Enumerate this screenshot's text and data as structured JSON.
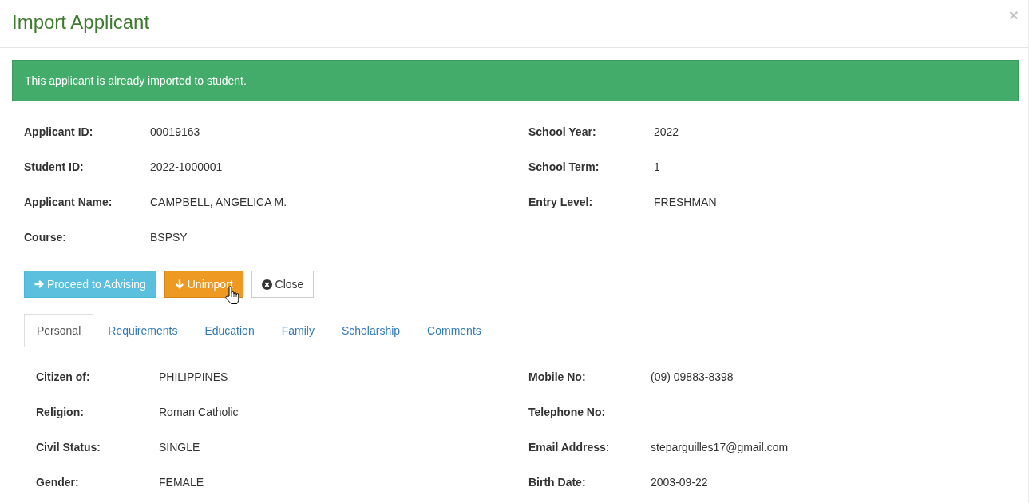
{
  "window": {
    "title": "Import Applicant",
    "close": "×"
  },
  "alert": {
    "message": "This applicant is already imported to student."
  },
  "summary": {
    "left": [
      {
        "label": "Applicant ID:",
        "value": "00019163"
      },
      {
        "label": "Student ID:",
        "value": "2022-1000001"
      },
      {
        "label": "Applicant Name:",
        "value": "CAMPBELL, ANGELICA M."
      },
      {
        "label": "Course:",
        "value": "BSPSY"
      }
    ],
    "right": [
      {
        "label": "School Year:",
        "value": "2022"
      },
      {
        "label": "School Term:",
        "value": "1"
      },
      {
        "label": "Entry Level:",
        "value": "FRESHMAN"
      }
    ]
  },
  "actions": [
    {
      "label": "Proceed to Advising",
      "kind": "proceed",
      "hovered": false
    },
    {
      "label": "Unimport",
      "kind": "unimport",
      "hovered": true
    },
    {
      "label": "Close",
      "kind": "close",
      "hovered": false
    }
  ],
  "tabs": [
    {
      "label": "Personal",
      "selected": true
    },
    {
      "label": "Requirements",
      "selected": false
    },
    {
      "label": "Education",
      "selected": false
    },
    {
      "label": "Family",
      "selected": false
    },
    {
      "label": "Scholarship",
      "selected": false
    },
    {
      "label": "Comments",
      "selected": false
    }
  ],
  "personal": {
    "left": [
      {
        "label": "Citizen of:",
        "value": "PHILIPPINES"
      },
      {
        "label": "Religion:",
        "value": "Roman Catholic"
      },
      {
        "label": "Civil Status:",
        "value": "SINGLE"
      },
      {
        "label": "Gender:",
        "value": "FEMALE"
      }
    ],
    "right": [
      {
        "label": "Mobile No:",
        "value": "(09) 09883-8398"
      },
      {
        "label": "Telephone No:"
      },
      {
        "label": "Email Address:",
        "value": "steparguilles17@gmail.com"
      },
      {
        "label": "Birth Date:",
        "value": "2003-09-22"
      }
    ]
  }
}
